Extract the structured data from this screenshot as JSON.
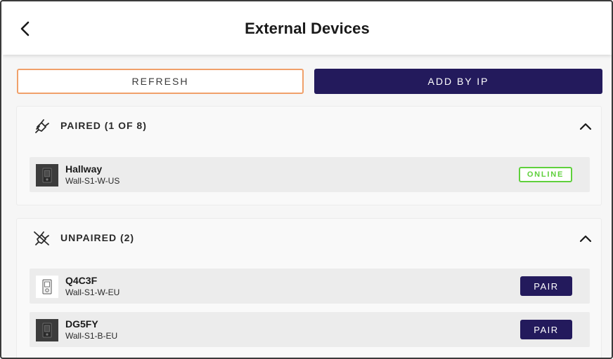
{
  "header": {
    "title": "External Devices",
    "back_icon": "chevron-left-icon"
  },
  "actions": {
    "refresh_label": "REFRESH",
    "add_by_ip_label": "ADD BY IP"
  },
  "colors": {
    "accent_navy": "#231a5c",
    "refresh_border": "#f0a06a",
    "online_green": "#5fd03c"
  },
  "paired": {
    "title": "PAIRED (1 OF 8)",
    "icon": "plug-icon",
    "expanded": true,
    "devices": [
      {
        "name": "Hallway",
        "model": "Wall-S1-W-US",
        "status": "ONLINE",
        "thumb": "dark"
      }
    ]
  },
  "unpaired": {
    "title": "UNPAIRED (2)",
    "icon": "plug-off-icon",
    "expanded": true,
    "devices": [
      {
        "name": "Q4C3F",
        "model": "Wall-S1-W-EU",
        "action": "PAIR",
        "thumb": "light"
      },
      {
        "name": "DG5FY",
        "model": "Wall-S1-B-EU",
        "action": "PAIR",
        "thumb": "dark"
      }
    ]
  }
}
